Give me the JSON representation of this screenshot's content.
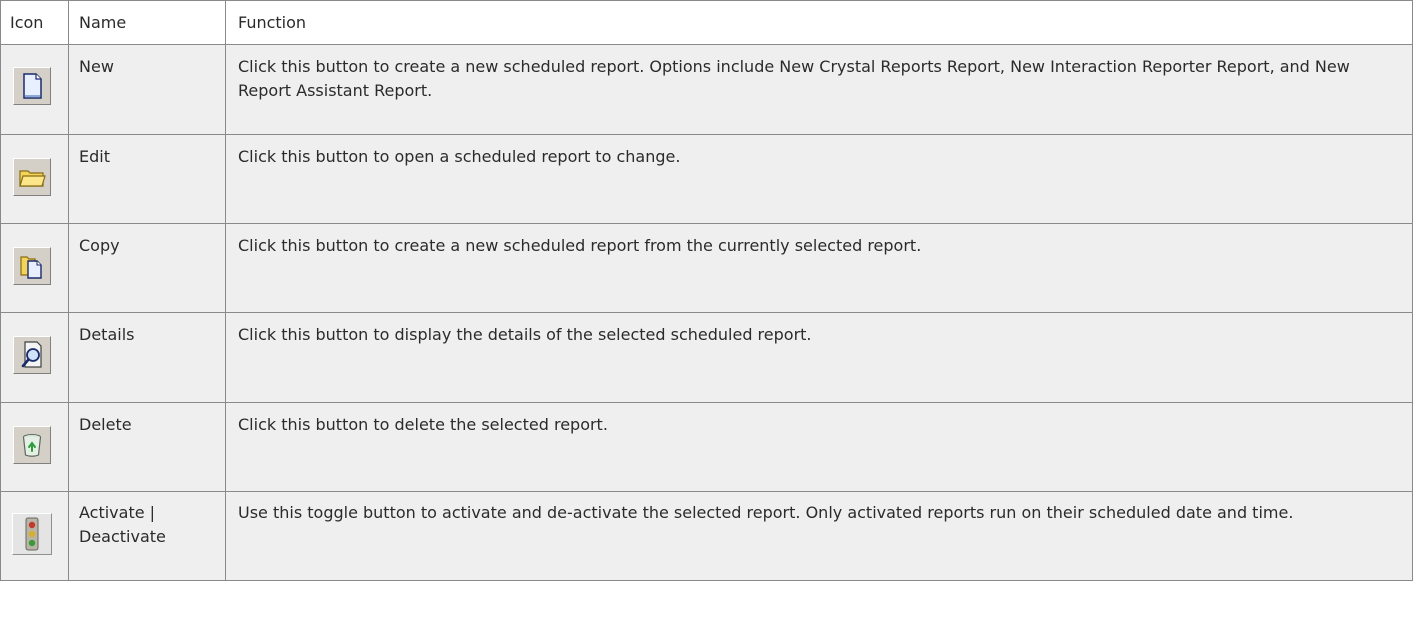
{
  "table": {
    "headers": {
      "icon": "Icon",
      "name": "Name",
      "function": "Function"
    },
    "rows": [
      {
        "icon": "new-document-icon",
        "name": "New",
        "function": "Click this button to create a new scheduled report. Options include New Crystal Reports Report, New Interaction Reporter Report, and New Report Assistant Report."
      },
      {
        "icon": "open-folder-icon",
        "name": "Edit",
        "function": "Click this button to open a scheduled report to change."
      },
      {
        "icon": "copy-icon",
        "name": "Copy",
        "function": "Click this button to create a new scheduled report from the currently selected report."
      },
      {
        "icon": "details-magnifier-icon",
        "name": "Details",
        "function": "Click this button to display the details of the selected scheduled report."
      },
      {
        "icon": "delete-recycle-bin-icon",
        "name": "Delete",
        "function": "Click this button to delete the selected report."
      },
      {
        "icon": "traffic-light-icon",
        "name": "Activate | Deactivate",
        "function": "Use this toggle button to activate and de-activate the selected report. Only activated reports run on their scheduled date and time."
      }
    ]
  }
}
